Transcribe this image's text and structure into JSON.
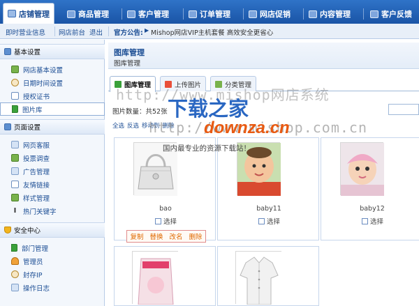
{
  "topnav": {
    "tabs": [
      {
        "label": "店铺管理",
        "active": true,
        "icon": "store-icon"
      },
      {
        "label": "商品管理",
        "active": false,
        "icon": "goods-icon"
      },
      {
        "label": "客户管理",
        "active": false,
        "icon": "customer-icon"
      },
      {
        "label": "订单管理",
        "active": false,
        "icon": "order-icon"
      },
      {
        "label": "网店促销",
        "active": false,
        "icon": "promotion-icon"
      },
      {
        "label": "内容管理",
        "active": false,
        "icon": "content-icon"
      },
      {
        "label": "客户反馈",
        "active": false,
        "icon": "feedback-icon"
      }
    ]
  },
  "subbar": {
    "links": [
      "即时营业信息",
      "网店前台",
      "退出"
    ],
    "notice_label": "官方公告:",
    "notice_text": "Mishop网店VIP主机套餐 高效安全更省心"
  },
  "sidebar": {
    "sections": [
      {
        "title": "基本设置",
        "icon": "settings-icon",
        "items": [
          {
            "label": "网店基本设置",
            "icon": "config-icon",
            "active": false
          },
          {
            "label": "日期时间设置",
            "icon": "clock-icon",
            "active": false
          },
          {
            "label": "授权证书",
            "icon": "certificate-icon",
            "active": false
          },
          {
            "label": "图片库",
            "icon": "flag-icon",
            "active": true
          }
        ]
      },
      {
        "title": "页面设置",
        "icon": "page-icon",
        "items": [
          {
            "label": "网页客服",
            "icon": "service-icon",
            "active": false
          },
          {
            "label": "投票调查",
            "icon": "vote-icon",
            "active": false
          },
          {
            "label": "广告管理",
            "icon": "ad-icon",
            "active": false
          },
          {
            "label": "友情链接",
            "icon": "link-icon",
            "active": false
          },
          {
            "label": "样式管理",
            "icon": "style-icon",
            "active": false
          },
          {
            "label": "热门关键字",
            "icon": "text-icon",
            "active": false
          }
        ]
      },
      {
        "title": "安全中心",
        "icon": "shield-icon",
        "items": [
          {
            "label": "部门管理",
            "icon": "flag-icon",
            "active": false
          },
          {
            "label": "管理员",
            "icon": "admin-icon",
            "active": false
          },
          {
            "label": "封存IP",
            "icon": "ip-icon",
            "active": false
          },
          {
            "label": "操作日志",
            "icon": "log-icon",
            "active": false
          }
        ]
      }
    ]
  },
  "main": {
    "title": "图库管理",
    "breadcrumb": "图库管理",
    "tabs": [
      {
        "label": "图库管理",
        "active": true
      },
      {
        "label": "上传图片",
        "active": false
      },
      {
        "label": "分类管理",
        "active": false
      }
    ],
    "count_label": "图片数量：共52张",
    "actions": [
      "全选",
      "反选",
      "移动到",
      "删除"
    ],
    "images": [
      {
        "name": "bao",
        "check_label": "选择",
        "kind": "handbag"
      },
      {
        "name": "baby11",
        "check_label": "选择",
        "kind": "baby-boy"
      },
      {
        "name": "baby12",
        "check_label": "选择",
        "kind": "baby-girl"
      },
      {
        "name": "",
        "check_label": "",
        "kind": "package"
      },
      {
        "name": "",
        "check_label": "",
        "kind": "shirt"
      }
    ],
    "image_ops": [
      "复制",
      "替换",
      "改名",
      "删除"
    ]
  },
  "watermark": {
    "line1": "http://www.mishop网店系统",
    "line2": "http://www.mishop.com.cn",
    "brand_cn": "下载之家",
    "brand_en": "downza.cn",
    "slogan": "国内最专业的资源下载站！"
  },
  "colors": {
    "nav_blue": "#1a54a6",
    "link_blue": "#1b4d94",
    "op_orange": "#e06a00",
    "watermark_blue": "#2a67c2",
    "watermark_orange": "#e85a12"
  }
}
